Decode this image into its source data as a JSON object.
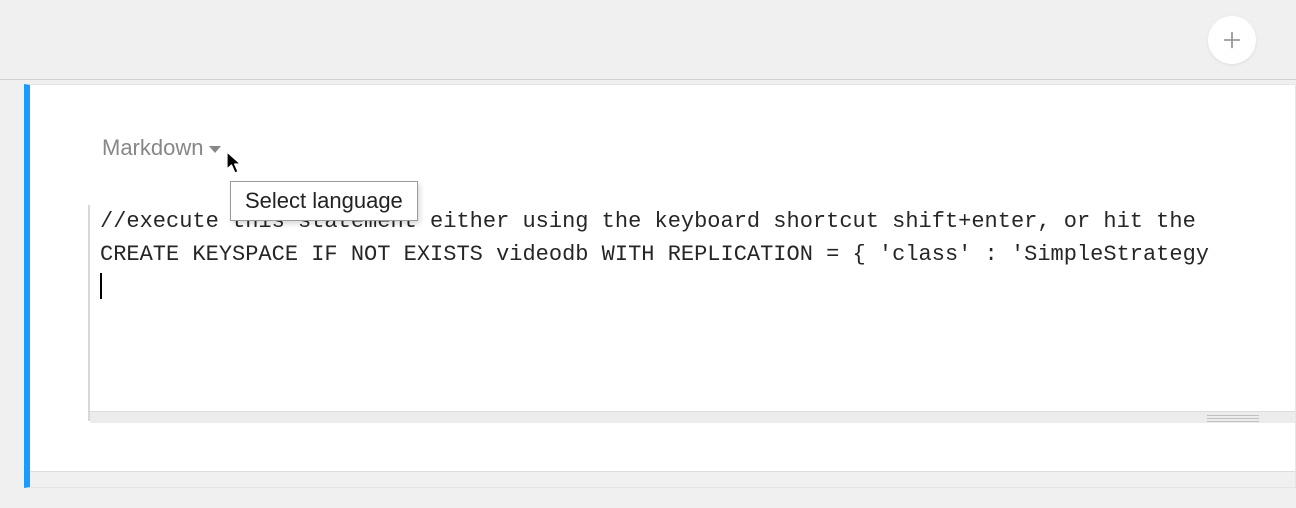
{
  "add_button_title": "Add",
  "cell": {
    "language_label": "Markdown",
    "tooltip": "Select language",
    "code_line1": "//execute this statement either using the keyboard shortcut shift+enter, or hit the",
    "code_line2": "CREATE KEYSPACE IF NOT EXISTS videodb WITH REPLICATION = { 'class' : 'SimpleStrategy"
  }
}
